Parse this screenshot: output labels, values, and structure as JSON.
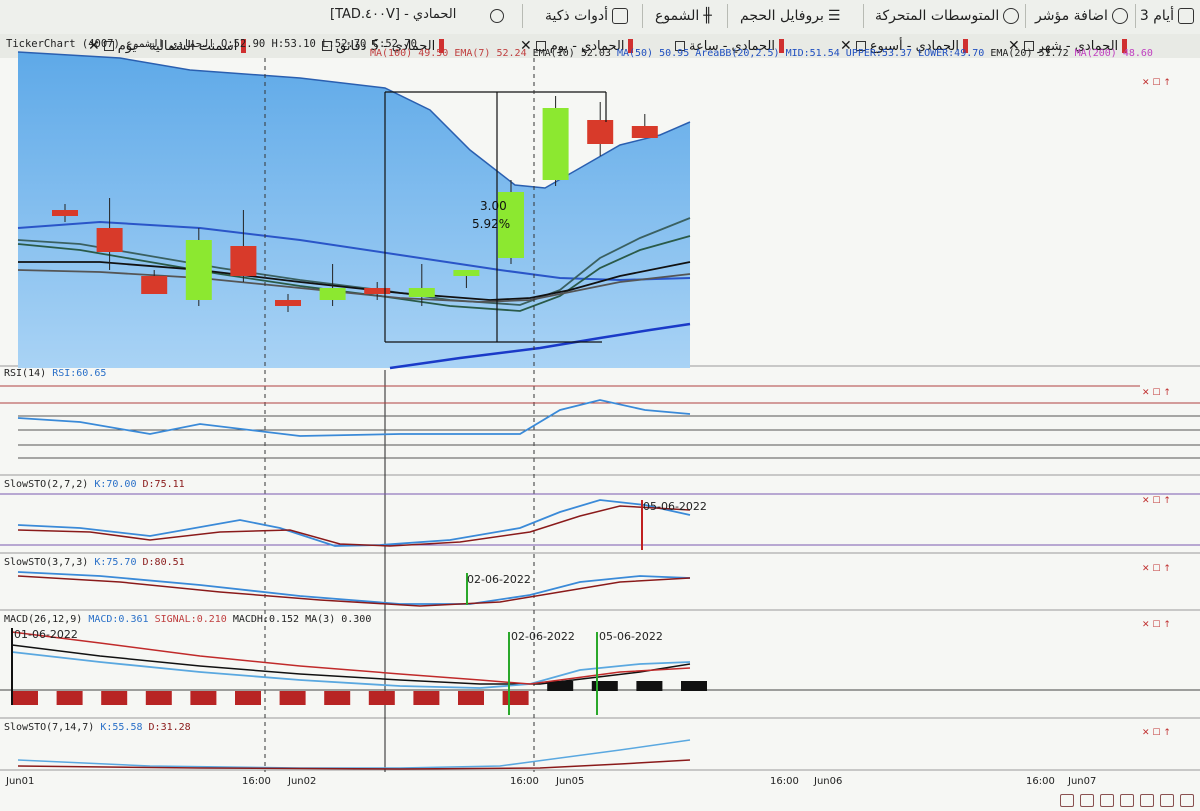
{
  "toolbar": {
    "items": [
      {
        "label": "3 أيام"
      },
      {
        "label": "اضافة مؤشر"
      },
      {
        "label": "المتوسطات المتحركة"
      },
      {
        "label": "بروفايل الحجم"
      },
      {
        "label": "الشموع"
      },
      {
        "label": "أدوات ذكية"
      },
      {
        "label": "[TAD.٤٠٠V] - الحمادي"
      }
    ]
  },
  "tabs": [
    {
      "label": "اسمنت الشمالية - يوم"
    },
    {
      "label": "الحمادي - 5 دقائق"
    },
    {
      "label": "الحمادي - يوم"
    },
    {
      "label": "الحمادي - ساعة"
    },
    {
      "label": "الحمادي - أسبوع"
    },
    {
      "label": "الحمادي - شهر"
    }
  ],
  "header": {
    "ticker": "TickerChart الحمادي الشموع (4007) O:52.90 H:53.10 L:52.70 C:52.70",
    "indicators": [
      {
        "text": "MA(100)",
        "color": "#c04040"
      },
      {
        "text": "49.50",
        "color": "#c04040"
      },
      {
        "text": "EMA(7)",
        "color": "#c04040"
      },
      {
        "text": "52.24",
        "color": "#c04040"
      },
      {
        "text": "EMA(10)",
        "color": "#222222"
      },
      {
        "text": "52.03",
        "color": "#222222"
      },
      {
        "text": "MA(50)",
        "color": "#2050c0"
      },
      {
        "text": "50.95",
        "color": "#2050c0"
      },
      {
        "text": "AreaBB(20,2.5)",
        "color": "#2050c0"
      },
      {
        "text": "MID:51.54",
        "color": "#2050c0"
      },
      {
        "text": "UPPER:53.37",
        "color": "#2050c0"
      },
      {
        "text": "LOWER:49.70",
        "color": "#2050c0"
      },
      {
        "text": "EMA(20)",
        "color": "#222222"
      },
      {
        "text": "51.72",
        "color": "#222222"
      },
      {
        "text": "MA(200)",
        "color": "#c040c0"
      },
      {
        "text": "48.60",
        "color": "#c040c0"
      }
    ]
  },
  "measure": {
    "change": "3.00",
    "percent": "5.92%"
  },
  "panels": {
    "rsi": {
      "name": "RSI(14)",
      "value": "RSI:60.65"
    },
    "sto1": {
      "name": "SlowSTO(2,7,2)",
      "k": "K:70.00",
      "d": "D:75.11",
      "marker_date": "05-06-2022"
    },
    "sto2": {
      "name": "SlowSTO(3,7,3)",
      "k": "K:75.70",
      "d": "D:80.51",
      "marker_date": "02-06-2022"
    },
    "macd": {
      "name": "MACD(26,12,9)",
      "macd": "MACD:0.361",
      "signal": "SIGNAL:0.210",
      "macdh": "MACDH:0.152",
      "ma": "MA(3)",
      "ma_val": "0.300",
      "date1": "01-06-2022",
      "date2": "02-06-2022",
      "date3": "05-06-2022"
    },
    "sto3": {
      "name": "SlowSTO(7,14,7)",
      "k": "K:55.58",
      "d": "D:31.28"
    }
  },
  "time_axis": [
    "Jun01",
    "16:00",
    "Jun02",
    "16:00",
    "Jun05",
    "16:00",
    "Jun06",
    "16:00",
    "Jun07"
  ],
  "colors": {
    "bb_fill": "#8ec3f0",
    "bb_dark": "#5ea9e8",
    "up": "#8ce830",
    "down": "#d83a2a"
  },
  "chart_data": {
    "type": "candlestick",
    "candles": [
      {
        "o": 51.5,
        "h": 51.6,
        "l": 51.3,
        "c": 51.4
      },
      {
        "o": 51.2,
        "h": 51.7,
        "l": 50.5,
        "c": 50.8
      },
      {
        "o": 50.4,
        "h": 50.5,
        "l": 50.1,
        "c": 50.1
      },
      {
        "o": 50.0,
        "h": 51.2,
        "l": 49.9,
        "c": 51.0
      },
      {
        "o": 50.9,
        "h": 51.5,
        "l": 50.3,
        "c": 50.4
      },
      {
        "o": 50.0,
        "h": 50.1,
        "l": 49.8,
        "c": 49.9
      },
      {
        "o": 50.0,
        "h": 50.6,
        "l": 49.9,
        "c": 50.2
      },
      {
        "o": 50.2,
        "h": 50.3,
        "l": 50.0,
        "c": 50.1
      },
      {
        "o": 50.05,
        "h": 50.6,
        "l": 49.9,
        "c": 50.2
      },
      {
        "o": 50.4,
        "h": 50.5,
        "l": 50.2,
        "c": 50.5
      },
      {
        "o": 50.7,
        "h": 52.0,
        "l": 50.6,
        "c": 51.8
      },
      {
        "o": 52.0,
        "h": 53.4,
        "l": 51.9,
        "c": 53.2
      },
      {
        "o": 53.0,
        "h": 53.3,
        "l": 52.4,
        "c": 52.6
      },
      {
        "o": 52.9,
        "h": 53.1,
        "l": 52.7,
        "c": 52.7
      }
    ]
  }
}
